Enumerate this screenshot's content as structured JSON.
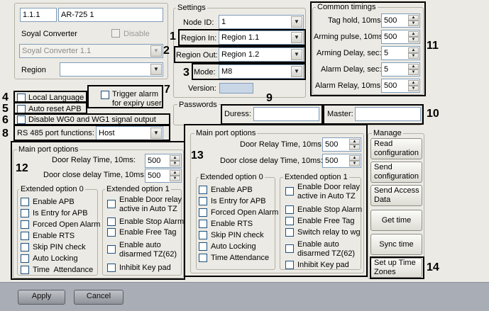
{
  "top_left": {
    "id_value": "1.1.1",
    "name_value": "AR-725 1",
    "converter_label": "Soyal Converter",
    "disable_label": "Disable",
    "converter_select": "Soyal Converter 1.1",
    "region_label": "Region",
    "region_value": ""
  },
  "settings": {
    "title": "Settings",
    "node_id_label": "Node ID:",
    "node_id_value": "1",
    "region_in_label": "Region In:",
    "region_in_value": "Region 1.1",
    "region_out_label": "Region Out:",
    "region_out_value": "Region 1.2",
    "mode_label": "Mode:",
    "mode_value": "M8",
    "version_label": "Version:",
    "version_value": ""
  },
  "common_timings": {
    "title": "Common timings",
    "rows": [
      {
        "label": "Tag hold, 10ms:",
        "value": "500"
      },
      {
        "label": "Arming pulse, 10ms:",
        "value": "500"
      },
      {
        "label": "Arming Delay, sec:",
        "value": "5"
      },
      {
        "label": "Alarm Delay, sec:",
        "value": "5"
      },
      {
        "label": "Alarm Relay, 10ms:",
        "value": "500"
      }
    ]
  },
  "options": {
    "local_language": "Local Language",
    "auto_reset_apb": "Auto reset APB",
    "trigger_alarm": "Trigger alarm\nfor expiry user",
    "disable_wg": "Disable WG0 and WG1 signal output",
    "rs485_label": "RS 485 port functions:",
    "rs485_value": "Host"
  },
  "passwords": {
    "title": "Passwords",
    "duress_label": "Duress:",
    "duress_value": "",
    "master_label": "Master:",
    "master_value": ""
  },
  "main_port_left": {
    "title": "Main port options",
    "door_relay_label": "Door Relay Time, 10ms:",
    "door_relay_value": "500",
    "door_close_label": "Door close delay Time, 10ms:",
    "door_close_value": "500",
    "ext0_title": "Extended option 0",
    "ext0_items": [
      "Enable APB",
      "Is Entry for APB",
      "Forced Open Alarm",
      "Enable RTS",
      "Skip PIN check",
      "Auto Locking",
      "Time  Attendance"
    ],
    "ext1_title": "Extended option 1",
    "ext1_items": [
      "Enable Door relay\nactive in Auto TZ",
      "Enable Stop Alarm",
      "Enable Free Tag",
      "Enable auto\ndisarmed TZ(62)",
      "Inhibit Key pad"
    ]
  },
  "main_port_mid": {
    "title": "Main port options",
    "door_relay_label": "Door Relay Time, 10ms:",
    "door_relay_value": "500",
    "door_close_label": "Door close delay Time, 10ms:",
    "door_close_value": "500",
    "ext0_title": "Extended option 0",
    "ext0_items": [
      "Enable APB",
      "Is Entry for APB",
      "Forced Open Alarm",
      "Enable RTS",
      "Skip PIN check",
      "Auto Locking",
      "Time Attendance"
    ],
    "ext1_title": "Extended option 1",
    "ext1_items": [
      "Enable Door relay\nactive in Auto TZ",
      "Enable Stop Alarm",
      "Enable Free Tag",
      "Switch relay to wg",
      "Enable auto\ndisarmed TZ(62)",
      "Inhibit Key pad"
    ]
  },
  "manage": {
    "title": "Manage",
    "read_config": "Read\nconfiguration",
    "send_config": "Send\nconfiguration",
    "send_access": "Send Access\nData",
    "get_time": "Get time",
    "sync_time": "Sync time",
    "setup_tz": "Set up Time\nZones"
  },
  "footer": {
    "apply": "Apply",
    "cancel": "Cancel"
  },
  "callouts": [
    "1",
    "2",
    "3",
    "4",
    "5",
    "6",
    "7",
    "8",
    "9",
    "10",
    "11",
    "12",
    "13",
    "14"
  ]
}
